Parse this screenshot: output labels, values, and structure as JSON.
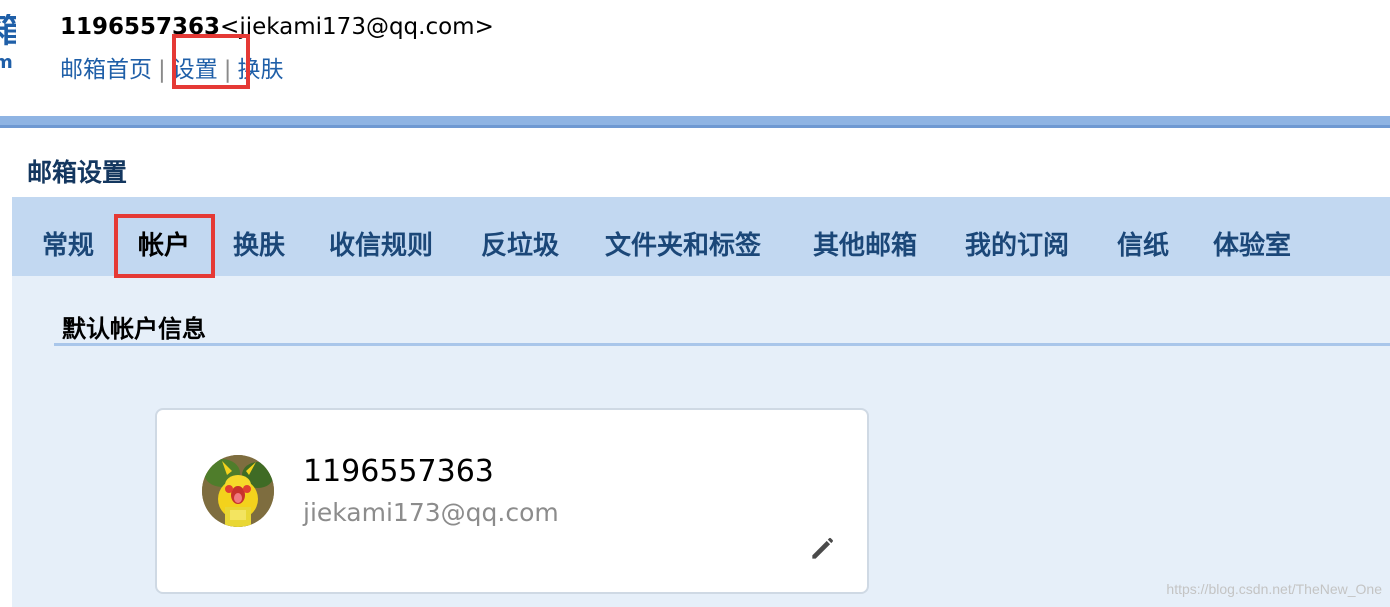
{
  "header": {
    "logo_char": "箱",
    "logo_sub": "m",
    "user_id": "1196557363",
    "user_email": "<jiekami173@qq.com>",
    "links": {
      "home": "邮箱首页",
      "settings": "设置",
      "skin": "换肤",
      "separator": "|"
    }
  },
  "settings": {
    "title": "邮箱设置",
    "tabs": [
      {
        "label": "常规"
      },
      {
        "label": "帐户",
        "active": true
      },
      {
        "label": "换肤"
      },
      {
        "label": "收信规则"
      },
      {
        "label": "反垃圾"
      },
      {
        "label": "文件夹和标签"
      },
      {
        "label": "其他邮箱"
      },
      {
        "label": "我的订阅"
      },
      {
        "label": "信纸"
      },
      {
        "label": "体验室"
      }
    ]
  },
  "account": {
    "section_title": "默认帐户信息",
    "name": "1196557363",
    "email": "jiekami173@qq.com",
    "edit_icon": "pencil-icon",
    "avatar": "avatar"
  },
  "watermark": "https://blog.csdn.net/TheNew_One",
  "colors": {
    "link": "#1f5fa8",
    "highlight": "#e53935",
    "header_bar": "#8fb4e3",
    "tab_bar": "#c2d8f1",
    "content_bg": "#e6eff9",
    "tab_text": "#1b4778",
    "title_text": "#14375f"
  }
}
